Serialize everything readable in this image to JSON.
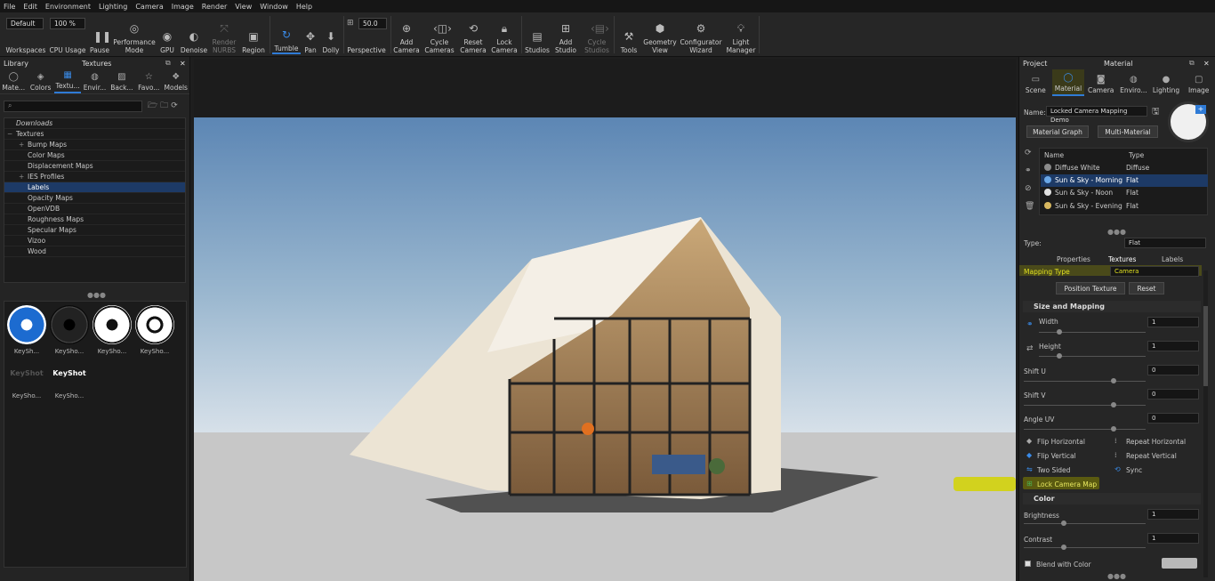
{
  "menu": [
    "File",
    "Edit",
    "Environment",
    "Lighting",
    "Camera",
    "Image",
    "Render",
    "View",
    "Window",
    "Help"
  ],
  "toolbar": {
    "workspace_value": "Default",
    "cpu_value": "100 %",
    "workspaces": "Workspaces",
    "cpu_usage": "CPU Usage",
    "pause": "Pause",
    "performance_mode": "Performance Mode",
    "gpu": "GPU",
    "denoise": "Denoise",
    "render_nurbs": "Render NURBS",
    "region": "Region",
    "tumble": "Tumble",
    "pan": "Pan",
    "dolly": "Dolly",
    "fov_value": "50.0",
    "perspective": "Perspective",
    "add_camera": "Add Camera",
    "cycle_cameras": "Cycle Cameras",
    "reset_camera": "Reset Camera",
    "lock_camera": "Lock Camera",
    "studios": "Studios",
    "add_studio": "Add Studio",
    "cycle_studios": "Cycle Studios",
    "tools": "Tools",
    "geometry_view": "Geometry View",
    "configurator_wizard": "Configurator Wizard",
    "light_manager": "Light Manager"
  },
  "library": {
    "title": "Library",
    "section": "Textures",
    "tabs": [
      "Mate...",
      "Colors",
      "Textu...",
      "Envir...",
      "Back...",
      "Favo...",
      "Models"
    ],
    "tree": {
      "downloads": "Downloads",
      "textures": "Textures",
      "children": [
        "Bump Maps",
        "Color Maps",
        "Displacement Maps",
        "IES Profiles",
        "Labels",
        "Opacity Maps",
        "OpenVDB",
        "Roughness Maps",
        "Specular Maps",
        "Vizoo",
        "Wood"
      ]
    },
    "thumbs": [
      "KeySh...",
      "KeySho...",
      "KeySho...",
      "KeySho...",
      "KeySho...",
      "KeySho..."
    ],
    "logo_text": "KeyShot"
  },
  "project": {
    "title": "Project",
    "section": "Material",
    "tabs": [
      "Scene",
      "Material",
      "Camera",
      "Enviro...",
      "Lighting",
      "Image"
    ],
    "name_label": "Name:",
    "name_value": "Locked Camera Mapping Demo",
    "material_graph": "Material Graph",
    "multi_material": "Multi-Material",
    "col_name": "Name",
    "col_type": "Type",
    "materials": [
      {
        "name": "Diffuse White",
        "type": "Diffuse",
        "color": "#8a8a8a"
      },
      {
        "name": "Sun & Sky - Morning",
        "type": "Flat",
        "color": "#6aa8e8"
      },
      {
        "name": "Sun & Sky - Noon",
        "type": "Flat",
        "color": "#e0e0e0"
      },
      {
        "name": "Sun & Sky - Evening",
        "type": "Flat",
        "color": "#d8b860"
      }
    ],
    "type_label": "Type:",
    "type_value": "Flat",
    "subtabs": [
      "Properties",
      "Textures",
      "Labels"
    ],
    "mapping_type_label": "Mapping Type",
    "mapping_type_value": "Camera",
    "position_texture": "Position Texture",
    "reset": "Reset",
    "size_mapping": "Size and Mapping",
    "width_label": "Width",
    "width_value": "1",
    "height_label": "Height",
    "height_value": "1",
    "shift_u_label": "Shift U",
    "shift_u_value": "0",
    "shift_v_label": "Shift V",
    "shift_v_value": "0",
    "angle_uv_label": "Angle UV",
    "angle_uv_value": "0",
    "flip_horizontal": "Flip Horizontal",
    "repeat_horizontal": "Repeat Horizontal",
    "flip_vertical": "Flip Vertical",
    "repeat_vertical": "Repeat Vertical",
    "two_sided": "Two Sided",
    "sync": "Sync",
    "lock_camera_map": "Lock Camera Map",
    "color_section": "Color",
    "brightness_label": "Brightness",
    "brightness_value": "1",
    "contrast_label": "Contrast",
    "contrast_value": "1",
    "blend_with_color": "Blend with Color"
  },
  "colors": {
    "accent": "#2f7bd6",
    "highlight": "#d4d400",
    "selection": "#1d3a66"
  }
}
